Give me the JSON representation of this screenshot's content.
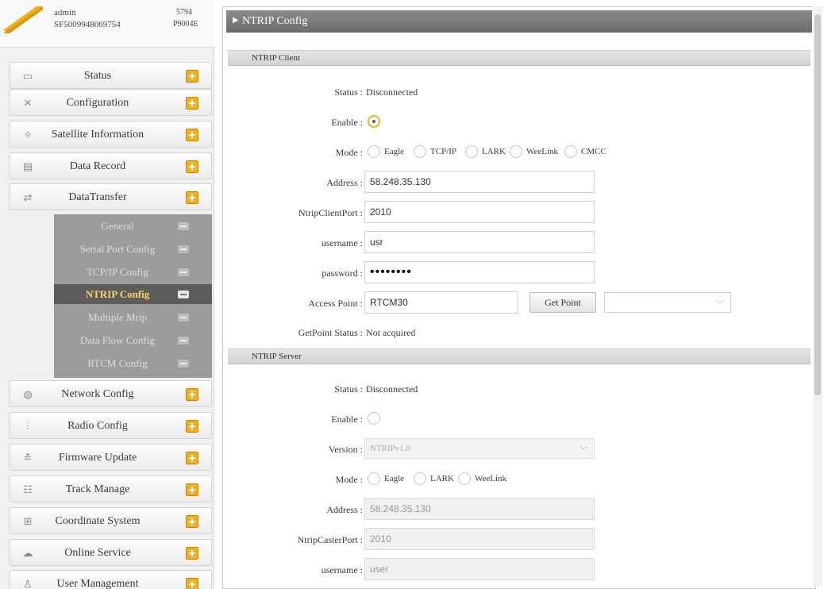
{
  "user": {
    "name": "admin",
    "serial": "SF5009948069754",
    "code": "5794",
    "product": "P9004E"
  },
  "sidebar": {
    "items": [
      {
        "label": "Status",
        "icon": "monitor-icon"
      },
      {
        "label": "Configuration",
        "icon": "wrench-icon"
      },
      {
        "label": "Satellite Information",
        "icon": "satellite-icon"
      },
      {
        "label": "Data Record",
        "icon": "record-icon"
      },
      {
        "label": "DataTransfer",
        "icon": "transfer-icon"
      },
      {
        "label": "Network Config",
        "icon": "network-icon"
      },
      {
        "label": "Radio Config",
        "icon": "radio-icon"
      },
      {
        "label": "Firmware Update",
        "icon": "firmware-icon"
      },
      {
        "label": "Track Manage",
        "icon": "track-icon"
      },
      {
        "label": "Coordinate System",
        "icon": "coordinate-icon"
      },
      {
        "label": "Online Service",
        "icon": "online-icon"
      },
      {
        "label": "User Management",
        "icon": "user-icon"
      }
    ],
    "subitems": [
      {
        "label": "General"
      },
      {
        "label": "Serial Port Config"
      },
      {
        "label": "TCP/IP Config"
      },
      {
        "label": "NTRIP Config",
        "active": true
      },
      {
        "label": "Multiple Mrip"
      },
      {
        "label": "Data Flow Config"
      },
      {
        "label": "RTCM Config"
      }
    ]
  },
  "main": {
    "title": "NTRIP Config",
    "client": {
      "header": "NTRIP Client",
      "status_label": "Status :",
      "status_value": "Disconnected",
      "enable_label": "Enable :",
      "mode_label": "Mode :",
      "mode_options": [
        "Eagle",
        "TCP/IP",
        "LARK",
        "WeeLink",
        "CMCC"
      ],
      "address_label": "Address :",
      "address_value": "58.248.35.130",
      "port_label": "NtripClientPort :",
      "port_value": "2010",
      "username_label": "username :",
      "username_value": "usr",
      "password_label": "password :",
      "password_value": "••••••••",
      "access_label": "Access Point :",
      "access_value": "RTCM30",
      "getpoint_button": "Get Point",
      "getpoint_status_label": "GetPoint Status :",
      "getpoint_status_value": "Not acquired"
    },
    "server": {
      "header": "NTRIP Server",
      "status_label": "Status :",
      "status_value": "Disconnected",
      "enable_label": "Enable :",
      "version_label": "Version :",
      "version_value": "NTRIPv1.0",
      "mode_label": "Mode :",
      "mode_options": [
        "Eagle",
        "LARK",
        "WeeLink"
      ],
      "address_label": "Address :",
      "address_value": "58.248.35.130",
      "port_label": "NtripCasterPort :",
      "port_value": "2010",
      "username_label": "username :",
      "username_value": "user"
    }
  },
  "colors": {
    "accent": "#f0b020",
    "title_bar": "#7c7c7c",
    "submenu_bg": "#9c9c9c",
    "submenu_active_bg": "#5c5c5c",
    "submenu_active_text": "#ffd36a"
  }
}
